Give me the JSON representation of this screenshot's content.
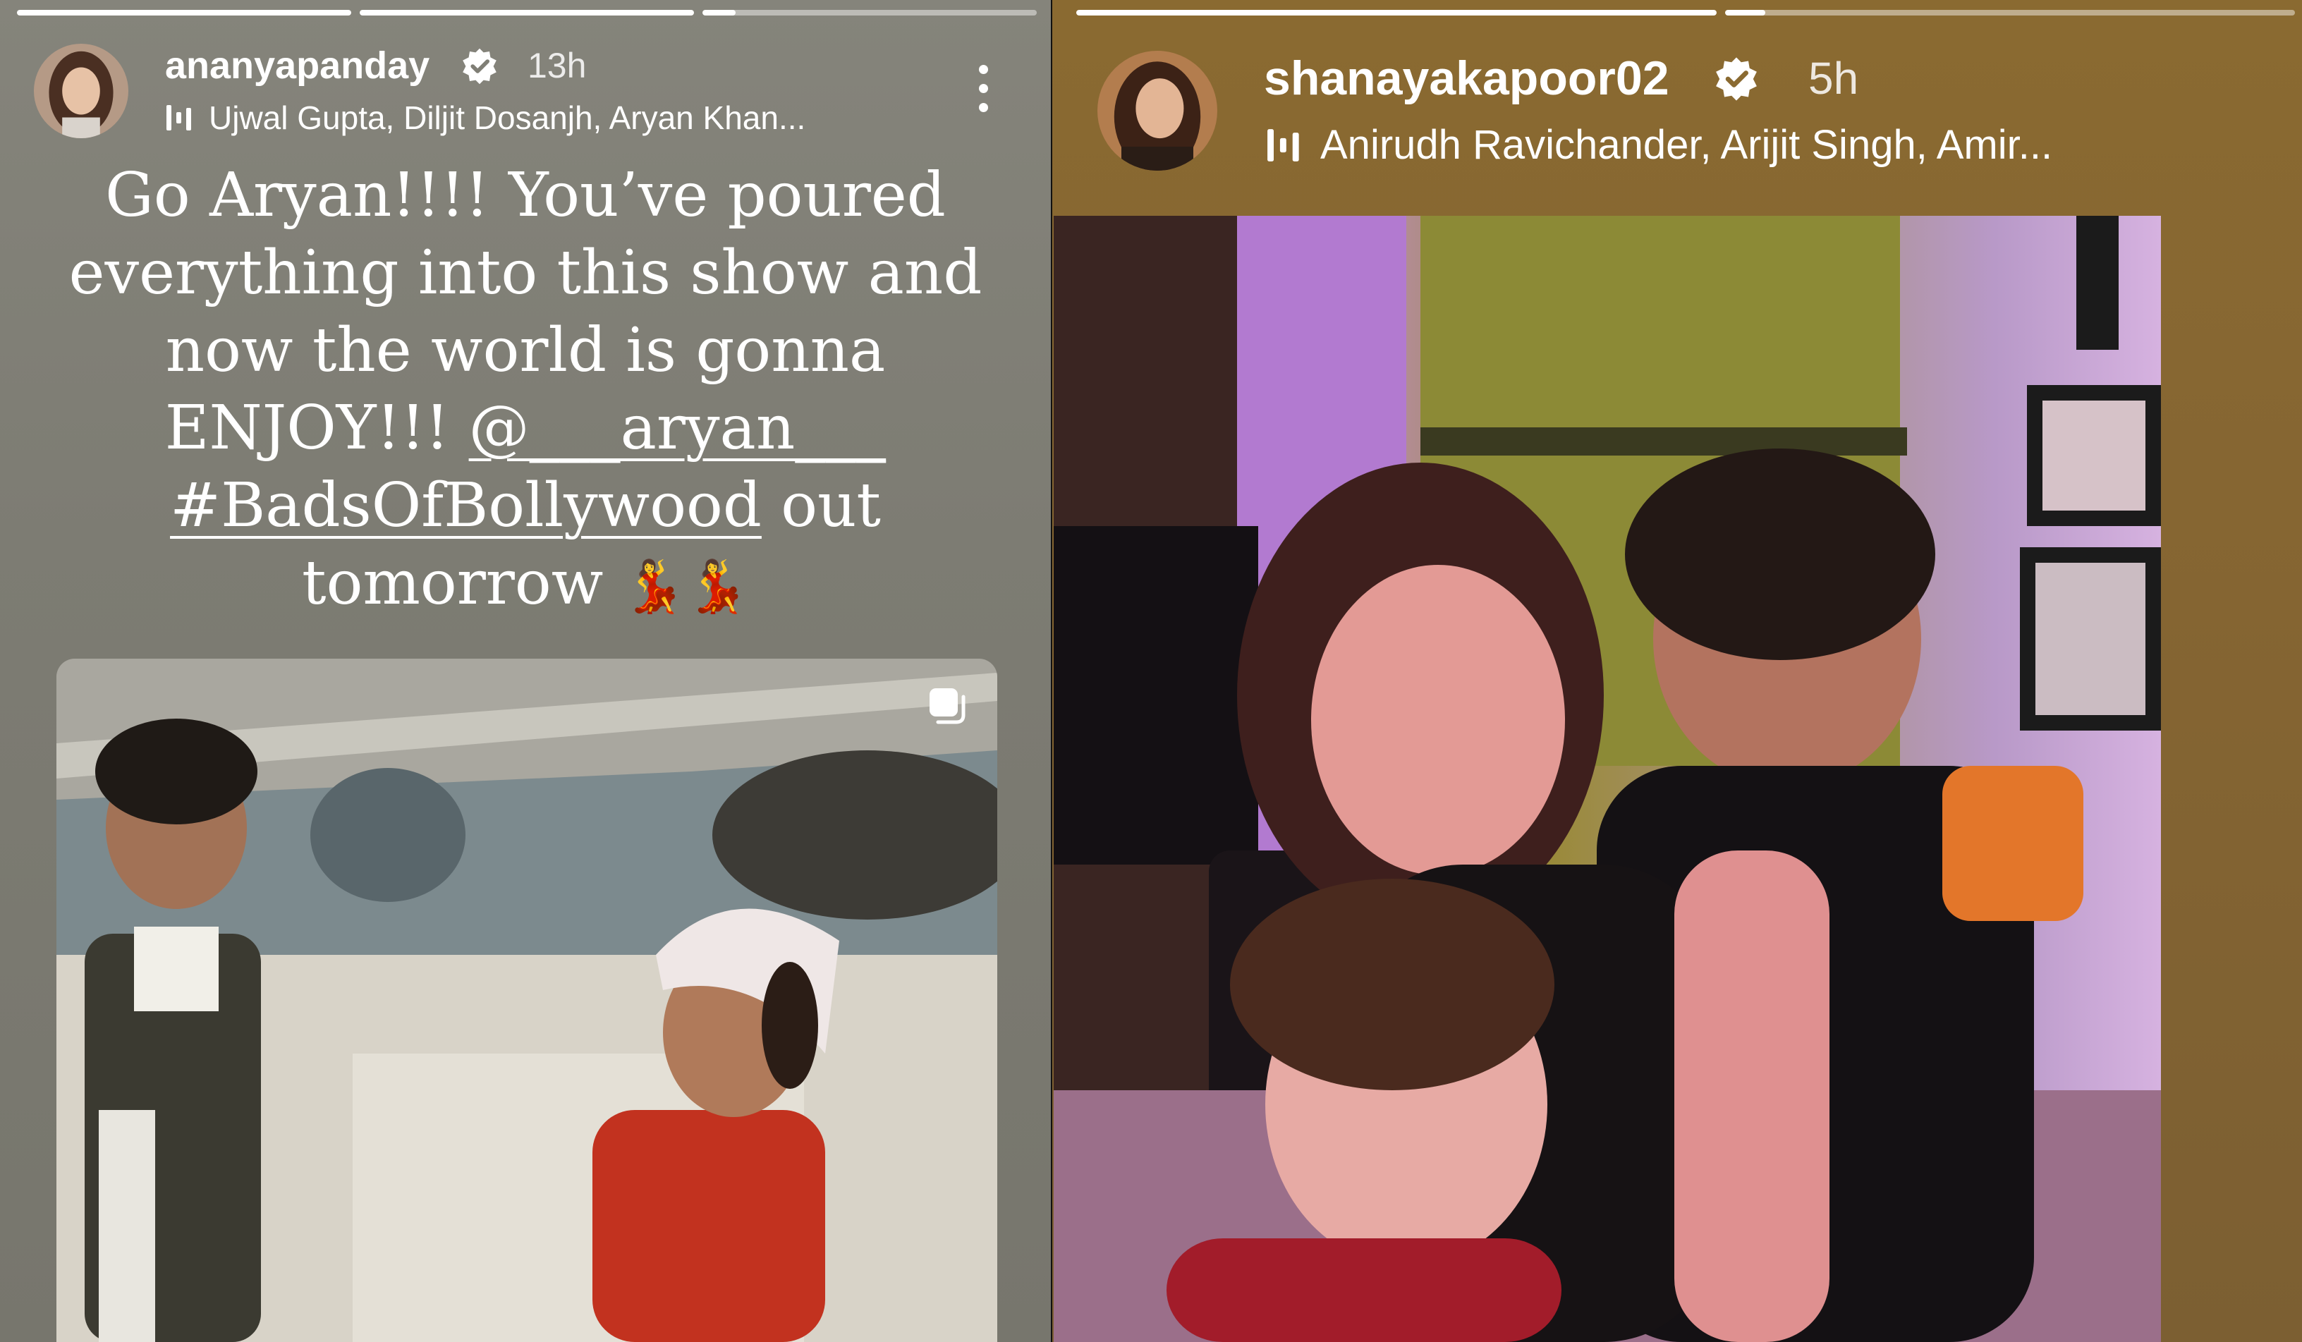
{
  "left_story": {
    "progress": [
      1,
      1,
      0.1
    ],
    "username": "ananyapanday",
    "time_ago": "13h",
    "music": "Ujwal Gupta, Diljit Dosanjh, Aryan Khan...",
    "caption": {
      "line1": "Go Aryan!!!! You’ve poured",
      "line2": "everything into this show and",
      "line3": "now the world is gonna",
      "line4_text": "ENJOY!!! ",
      "mention": "@___aryan___",
      "hashtag": "#BadsOfBollywood",
      "line5_rest": " out",
      "line6": "tomorrow",
      "emoji": "💃💃"
    }
  },
  "right_story": {
    "progress": [
      1,
      0.07
    ],
    "username": "shanayakapoor02",
    "time_ago": "5h",
    "music": "Anirudh Ravichander, Arijit Singh, Amir..."
  },
  "icons": {
    "verified": "verified-badge-icon",
    "music": "music-bars-icon",
    "more": "more-options-icon",
    "repost": "repost-icon"
  },
  "colors": {
    "left_bg": "#7f7e75",
    "right_bg": "#85652f",
    "verified_badge": "#ffffff"
  }
}
